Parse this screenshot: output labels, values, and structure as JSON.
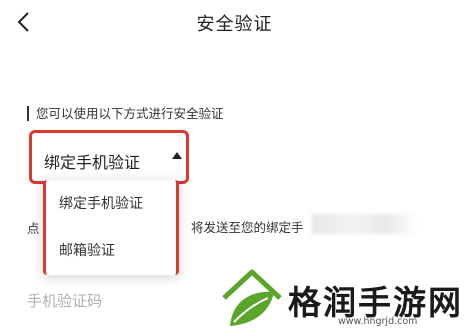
{
  "header": {
    "title": "安全验证",
    "back_icon": "chevron-left-icon"
  },
  "instruction": "您可以使用以下方式进行安全验证",
  "method_select": {
    "selected_label": "绑定手机验证",
    "caret_icon": "caret-up-icon",
    "highlight_color": "#d93a2e"
  },
  "dropdown": {
    "options": [
      "绑定手机验证",
      "邮箱验证"
    ]
  },
  "hint": {
    "prefix": "点",
    "text": "将发送至您的绑定手"
  },
  "code_input": {
    "placeholder": "手机验证码"
  },
  "watermark": {
    "text": "格润手游网",
    "url": "www.hngrjd.com",
    "logo_icon": "house-leaf-logo-icon",
    "logo_color": "#5aa62b"
  }
}
